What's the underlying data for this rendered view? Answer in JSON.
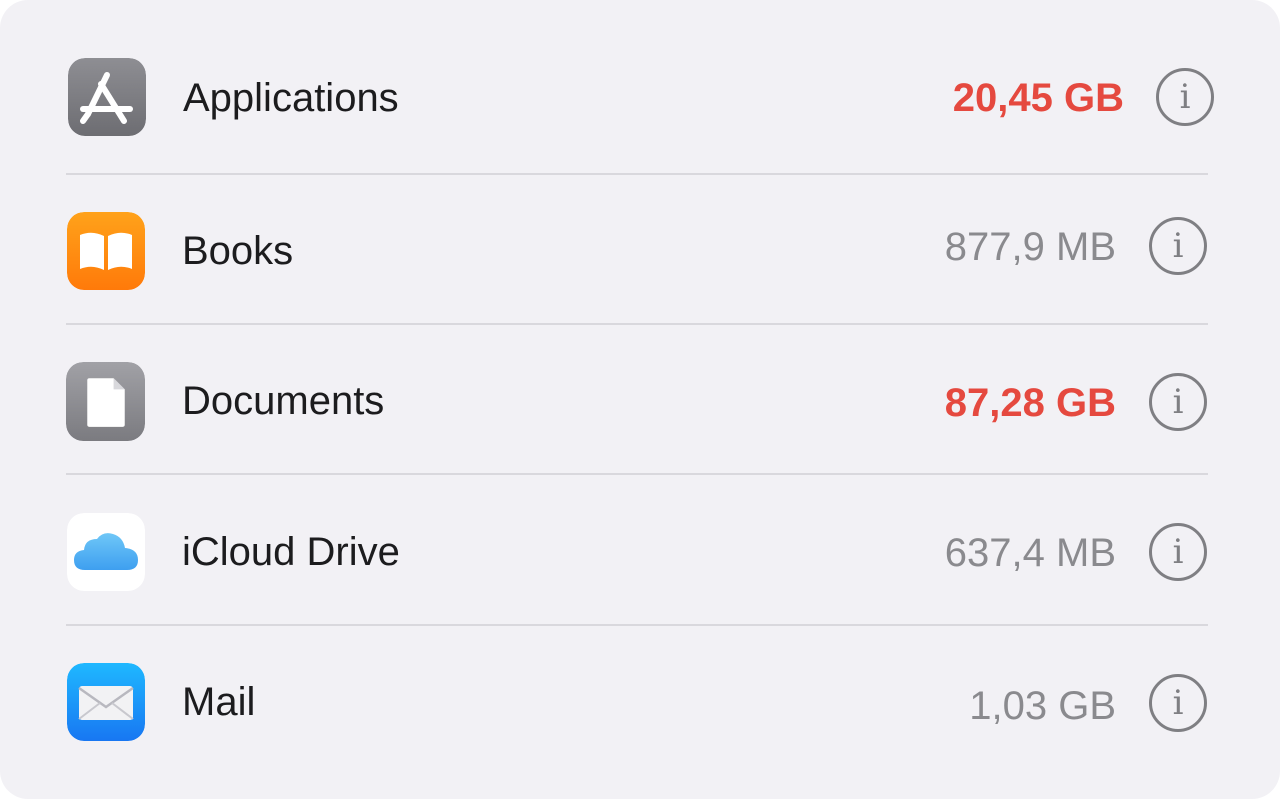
{
  "storage_list": {
    "items": [
      {
        "name": "Applications",
        "size": "20,45 GB",
        "warning": true,
        "icon": "app-store-icon",
        "info_glyph": "i"
      },
      {
        "name": "Books",
        "size": "877,9 MB",
        "warning": false,
        "icon": "books-icon",
        "info_glyph": "i"
      },
      {
        "name": "Documents",
        "size": "87,28 GB",
        "warning": true,
        "icon": "document-icon",
        "info_glyph": "i"
      },
      {
        "name": "iCloud Drive",
        "size": "637,4 MB",
        "warning": false,
        "icon": "icloud-icon",
        "info_glyph": "i"
      },
      {
        "name": "Mail",
        "size": "1,03 GB",
        "warning": false,
        "icon": "mail-icon",
        "info_glyph": "i"
      }
    ]
  },
  "colors": {
    "background": "#f2f1f5",
    "warning_text": "#e5493f",
    "secondary_text": "#8a8a8e",
    "primary_text": "#1c1c1e"
  }
}
